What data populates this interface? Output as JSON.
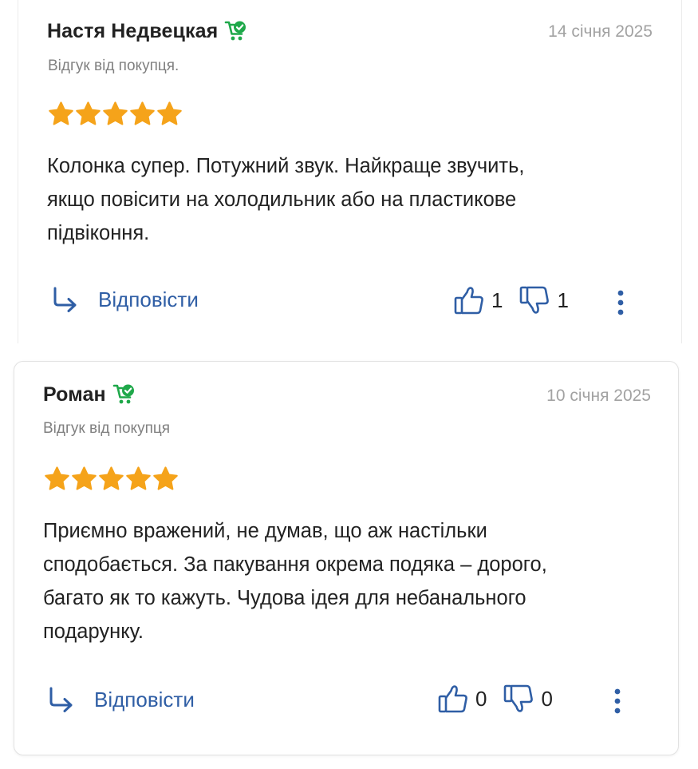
{
  "colors": {
    "accent": "#2f5ea5",
    "star": "#f5a31a",
    "verified": "#1fa84a",
    "muted": "#a2a2a2"
  },
  "reviews": [
    {
      "author": "Настя Недвецкая",
      "badge_icon": "verified-buyer-cart-icon",
      "date": "14 січня 2025",
      "subtitle": "Відгук від покупця.",
      "rating": 5,
      "text_lines": [
        "Колонка супер. Потужний звук. Найкраще звучить,",
        "якщо повісити на холодильник або на пластикове",
        "підвіконня."
      ],
      "reply_label": "Відповісти",
      "likes": "1",
      "dislikes": "1"
    },
    {
      "author": "Роман",
      "badge_icon": "verified-buyer-cart-icon",
      "date": "10 січня 2025",
      "subtitle": "Відгук від покупця",
      "rating": 5,
      "text_lines": [
        "Приємно вражений, не думав, що аж настільки",
        "сподобається. За пакування окрема подяка – дорого,",
        "багато як то кажуть. Чудова ідея для небанального",
        "подарунку."
      ],
      "reply_label": "Відповісти",
      "likes": "0",
      "dislikes": "0"
    }
  ]
}
